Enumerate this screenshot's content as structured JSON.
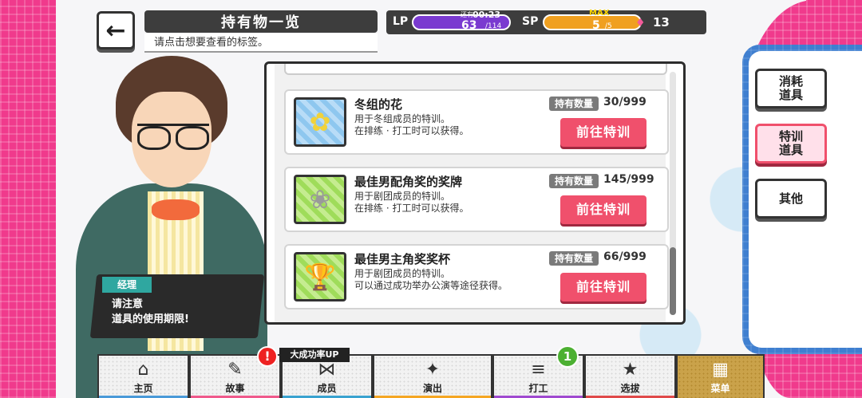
{
  "header": {
    "back_icon": "←",
    "title": "持有物一览",
    "subtitle": "请点击想要查看的标签。"
  },
  "status": {
    "lp_label": "LP",
    "lp_timer_label": "还有",
    "lp_timer": "00:23",
    "lp_value": "63",
    "lp_max": "/114",
    "sp_label": "SP",
    "sp_max_tag": "MAX",
    "sp_value": "5",
    "sp_max": "/5",
    "gem_icon": "♦",
    "gem_count": "13",
    "lp_color": "#7a3ad0",
    "sp_color": "#f0a020"
  },
  "speech": {
    "speaker": "经理",
    "line1": "请注意",
    "line2": "道具的使用期限!"
  },
  "items": [
    {
      "name": "冬组的花",
      "qty_label": "持有数量",
      "qty": "30/999",
      "desc1": "用于冬组成员的特训。",
      "desc2": "在排练 · 打工时可以获得。",
      "button": "前往特训",
      "icon": "flower-icon",
      "icon_glyph": "✿"
    },
    {
      "name": "最佳男配角奖的奖牌",
      "qty_label": "持有数量",
      "qty": "145/999",
      "desc1": "用于剧团成员的特训。",
      "desc2": "在排练 · 打工时可以获得。",
      "button": "前往特训",
      "icon": "medal-icon",
      "icon_glyph": "❀"
    },
    {
      "name": "最佳男主角奖奖杯",
      "qty_label": "持有数量",
      "qty": "66/999",
      "desc1": "用于剧团成员的特训。",
      "desc2": "可以通过成功举办公演等途径获得。",
      "button": "前往特训",
      "icon": "trophy-icon",
      "icon_glyph": "🏆"
    }
  ],
  "categories": [
    {
      "label_line1": "消耗",
      "label_line2": "道具"
    },
    {
      "label_line1": "特训",
      "label_line2": "道具"
    },
    {
      "label_line1": "其他",
      "label_line2": ""
    }
  ],
  "bottom_nav": [
    {
      "label": "主页",
      "glyph": "⌂",
      "color": "#4a9ad8"
    },
    {
      "label": "故事",
      "glyph": "✎",
      "color": "#f05a8c"
    },
    {
      "label": "成员",
      "glyph": "⋈",
      "color": "#3aa3d0"
    },
    {
      "label": "演出",
      "glyph": "✦",
      "color": "#f5a623"
    },
    {
      "label": "打工",
      "glyph": "≡",
      "color": "#a04ad0"
    },
    {
      "label": "选拔",
      "glyph": "★",
      "color": "#e04a4a"
    },
    {
      "label": "菜单",
      "glyph": "▦",
      "color": "#caa24a"
    }
  ],
  "badges": {
    "story_alert": "!",
    "boost_tag": "大成功率UP",
    "work_count": "1"
  }
}
